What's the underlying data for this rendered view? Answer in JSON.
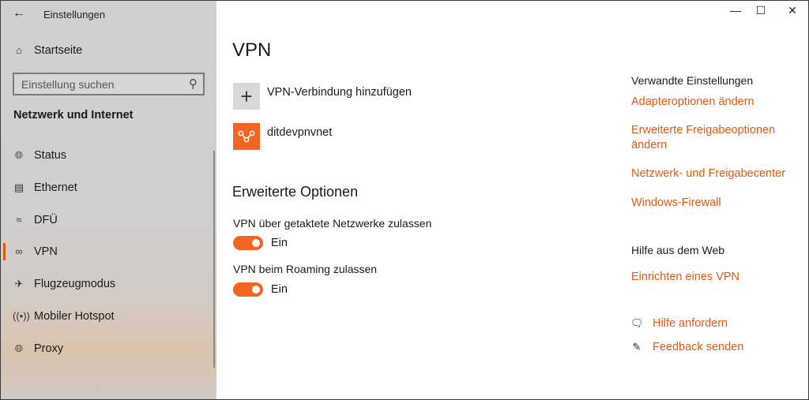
{
  "app": {
    "title": "Einstellungen"
  },
  "sidebar": {
    "home": "Startseite",
    "search_placeholder": "Einstellung suchen",
    "section": "Netzwerk und Internet",
    "items": [
      {
        "label": "Status",
        "icon": "globe-icon"
      },
      {
        "label": "Ethernet",
        "icon": "ethernet-icon"
      },
      {
        "label": "DFÜ",
        "icon": "dialup-icon"
      },
      {
        "label": "VPN",
        "icon": "vpn-icon",
        "active": true
      },
      {
        "label": "Flugzeugmodus",
        "icon": "airplane-icon"
      },
      {
        "label": "Mobiler Hotspot",
        "icon": "hotspot-icon"
      },
      {
        "label": "Proxy",
        "icon": "globe-icon"
      }
    ]
  },
  "main": {
    "title": "VPN",
    "add_label": "VPN-Verbindung hinzufügen",
    "connection": "ditdevpnvnet",
    "advanced_heading": "Erweiterte Optionen",
    "options": [
      {
        "label": "VPN über getaktete Netzwerke zulassen",
        "state": "Ein",
        "on": true
      },
      {
        "label": "VPN beim Roaming zulassen",
        "state": "Ein",
        "on": true
      }
    ]
  },
  "right": {
    "related_heading": "Verwandte Einstellungen",
    "links": [
      "Adapteroptionen ändern",
      "Erweiterte Freigabeoptionen ändern",
      "Netzwerk- und Freigabecenter",
      "Windows-Firewall"
    ],
    "web_heading": "Hilfe aus dem Web",
    "web_link": "Einrichten eines VPN",
    "help": "Hilfe anfordern",
    "feedback": "Feedback senden"
  },
  "colors": {
    "accent": "#f26522",
    "link": "#e8570e"
  }
}
